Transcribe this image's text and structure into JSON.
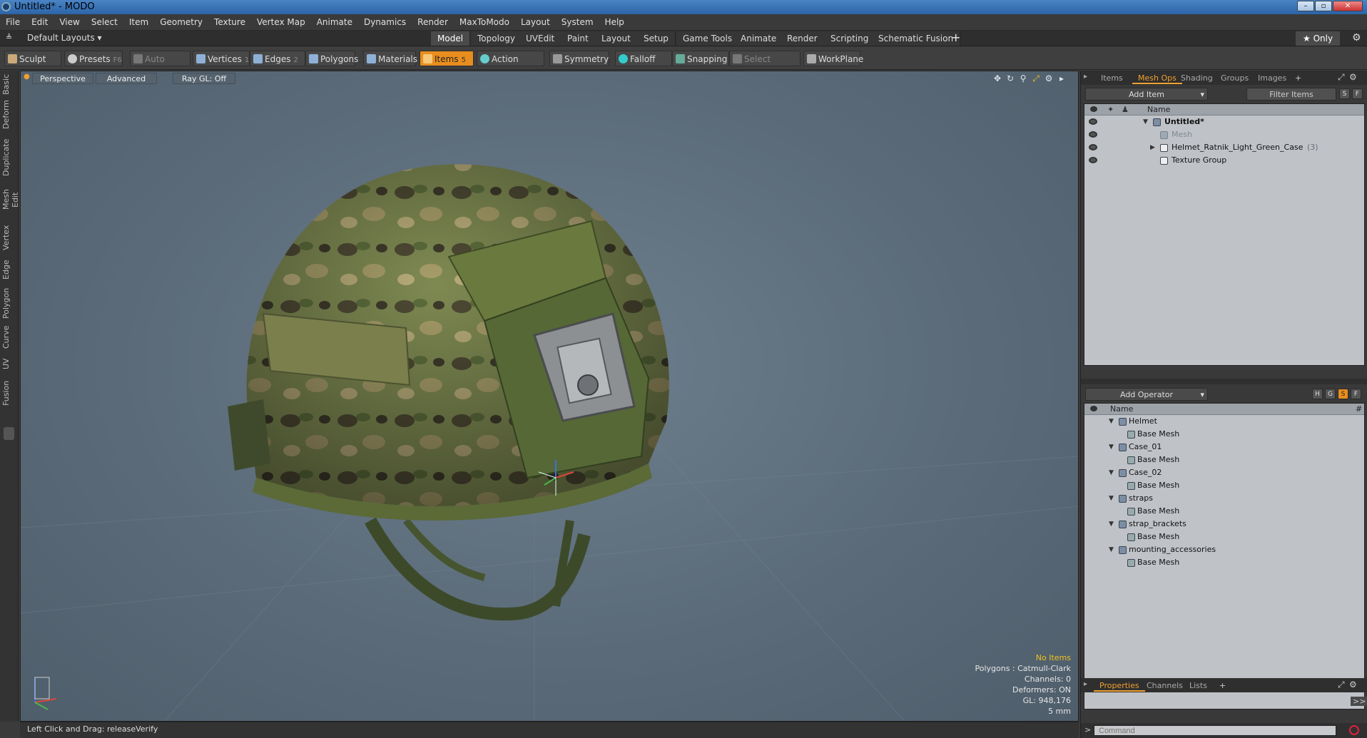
{
  "window": {
    "title": "Untitled* - MODO"
  },
  "menu": [
    "File",
    "Edit",
    "View",
    "Select",
    "Item",
    "Geometry",
    "Texture",
    "Vertex Map",
    "Animate",
    "Dynamics",
    "Render",
    "MaxToModo",
    "Layout",
    "System",
    "Help"
  ],
  "layout_selector": "Default Layouts ▾",
  "layout_tabs": [
    "Model",
    "Topology",
    "UVEdit",
    "Paint",
    "Layout",
    "Setup",
    "Game Tools",
    "Animate",
    "Render",
    "Scripting",
    "Schematic Fusion"
  ],
  "layout_active": "Model",
  "only_button": "★ Only",
  "toolbar": {
    "sculpt": "Sculpt",
    "presets": "Presets",
    "presets_key": "F6",
    "auto_select": "Auto Select",
    "vertices": "Vertices",
    "vertices_key": "1",
    "edges": "Edges",
    "edges_key": "2",
    "polygons": "Polygons",
    "materials": "Materials",
    "items": "Items",
    "items_key": "5",
    "action_center": "Action Center",
    "symmetry": "Symmetry",
    "falloff": "Falloff",
    "snapping": "Snapping",
    "select_through": "Select Through",
    "workplane": "WorkPlane"
  },
  "left_tabs": [
    "Basic",
    "Deform",
    "Duplicate",
    "Mesh Edit",
    "Vertex",
    "Edge",
    "Polygon",
    "Curve",
    "UV",
    "Fusion"
  ],
  "viewport": {
    "view": "Perspective",
    "mode": "Advanced",
    "raygl": "Ray GL: Off",
    "info": {
      "items": "No Items",
      "polygons": "Polygons : Catmull-Clark",
      "channels": "Channels: 0",
      "deformers": "Deformers: ON",
      "gl": "GL: 948,176",
      "scale": "5 mm"
    }
  },
  "status": {
    "text": "Left Click and Drag:  releaseVerify"
  },
  "items_panel": {
    "tabs": [
      "Items",
      "Mesh Ops",
      "Shading",
      "Groups",
      "Images"
    ],
    "active_tab": "Mesh Ops",
    "add_item": "Add Item",
    "filter": "Filter Items",
    "col_name": "Name",
    "rows": [
      {
        "label": "Untitled*"
      },
      {
        "label": "Mesh"
      },
      {
        "label": "Helmet_Ratnik_Light_Green_Case",
        "count": "(3)"
      },
      {
        "label": "Texture Group"
      }
    ]
  },
  "meshops_panel": {
    "add_operator": "Add Operator",
    "col_name": "Name",
    "col_hash": "#",
    "rows": [
      {
        "label": "Helmet"
      },
      {
        "label": "Base Mesh"
      },
      {
        "label": "Case_01"
      },
      {
        "label": "Base Mesh"
      },
      {
        "label": "Case_02"
      },
      {
        "label": "Base Mesh"
      },
      {
        "label": "straps"
      },
      {
        "label": "Base Mesh"
      },
      {
        "label": "strap_brackets"
      },
      {
        "label": "Base Mesh"
      },
      {
        "label": "mounting_accessories"
      },
      {
        "label": "Base Mesh"
      }
    ]
  },
  "bottom_tabs": [
    "Properties",
    "Channels",
    "Lists"
  ],
  "bottom_active": "Properties",
  "command": {
    "placeholder": "Command"
  },
  "colors": {
    "accent": "#e98e1e",
    "viewport": "#5f6f7c"
  }
}
